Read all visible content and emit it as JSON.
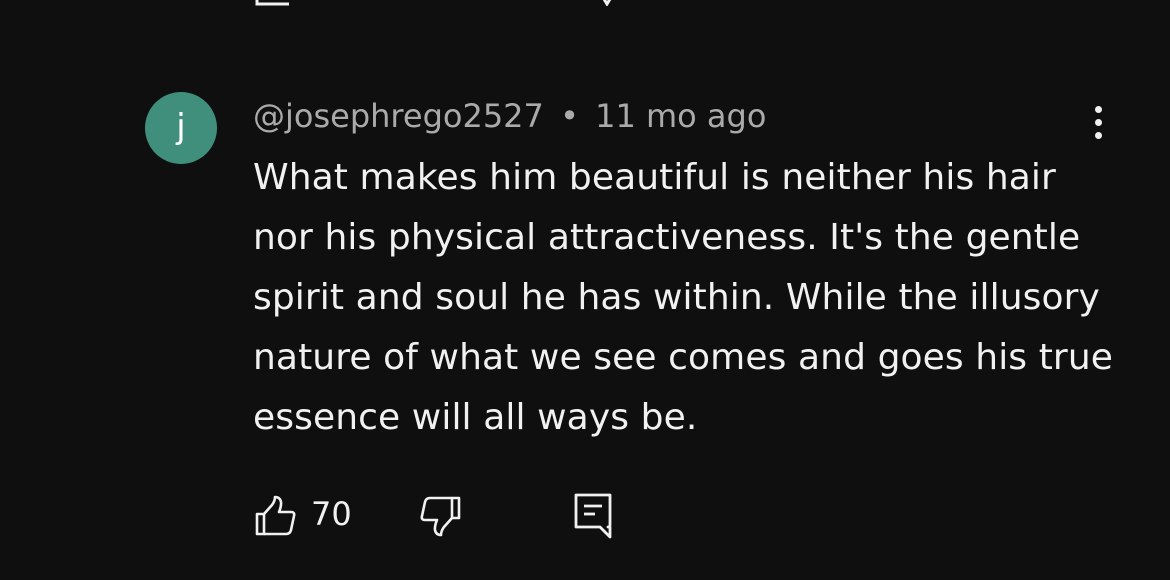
{
  "comment": {
    "avatar_letter": "j",
    "avatar_color": "#3f8f7c",
    "author": "@josephrego2527",
    "separator": "•",
    "timestamp": "11 mo ago",
    "text": "What makes him beautiful is neither his hair nor his physical attractiveness. It's the gentle spirit and soul he has within. While the illusory nature of what we see comes and goes his true essence will all ways be.",
    "like_count": "70",
    "icons": {
      "like": "thumbs-up-icon",
      "dislike": "thumbs-down-icon",
      "reply": "comment-reply-icon",
      "more": "more-vertical-icon"
    }
  },
  "colors": {
    "background": "#0f0f0f",
    "text_primary": "#f1f1f1",
    "text_secondary": "#aaaaaa"
  }
}
